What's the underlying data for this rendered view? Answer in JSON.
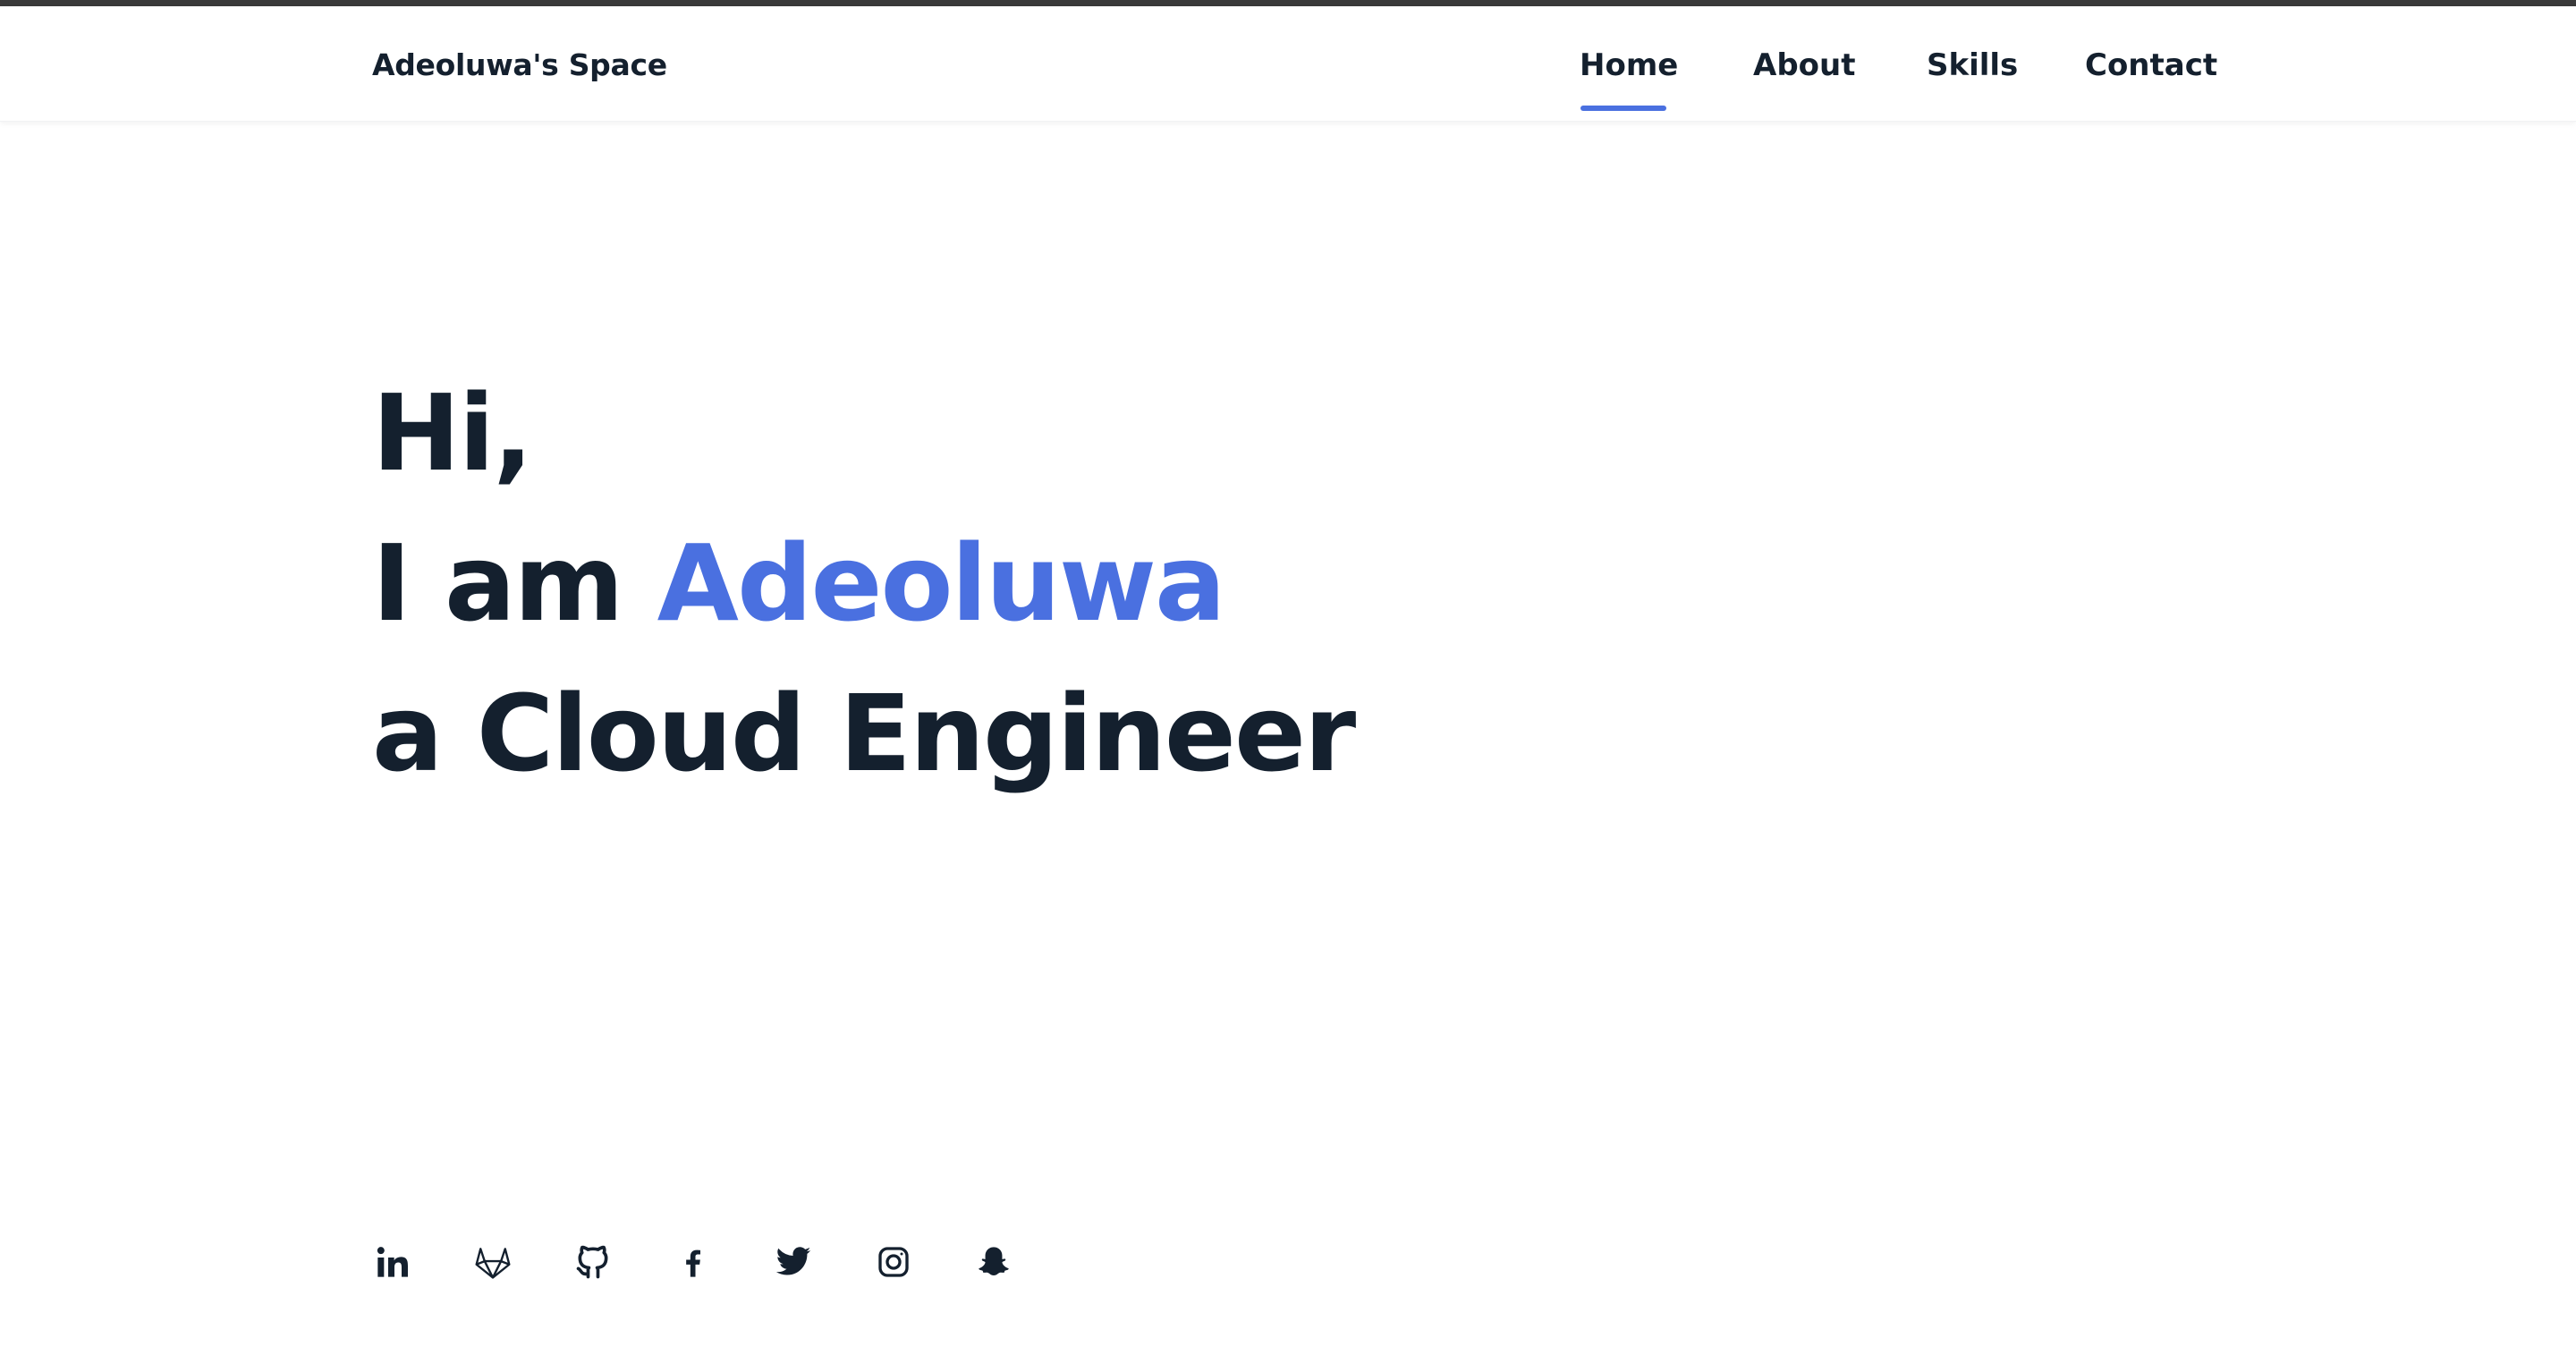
{
  "header": {
    "brand": "Adeoluwa's Space",
    "nav": [
      {
        "label": "Home",
        "active": true
      },
      {
        "label": "About",
        "active": false
      },
      {
        "label": "Skills",
        "active": false
      },
      {
        "label": "Contact",
        "active": false
      }
    ]
  },
  "hero": {
    "line1": "Hi,",
    "line2_prefix": "I am ",
    "line2_name": "Adeoluwa",
    "line3": "a Cloud Engineer"
  },
  "socials": [
    {
      "icon": "linkedin-icon"
    },
    {
      "icon": "gitlab-icon"
    },
    {
      "icon": "github-icon"
    },
    {
      "icon": "facebook-icon"
    },
    {
      "icon": "twitter-icon"
    },
    {
      "icon": "instagram-icon"
    },
    {
      "icon": "snapchat-icon"
    }
  ],
  "colors": {
    "text": "#14202e",
    "accent": "#4a70e0",
    "topbar": "#3a3a3a",
    "background": "#ffffff"
  }
}
